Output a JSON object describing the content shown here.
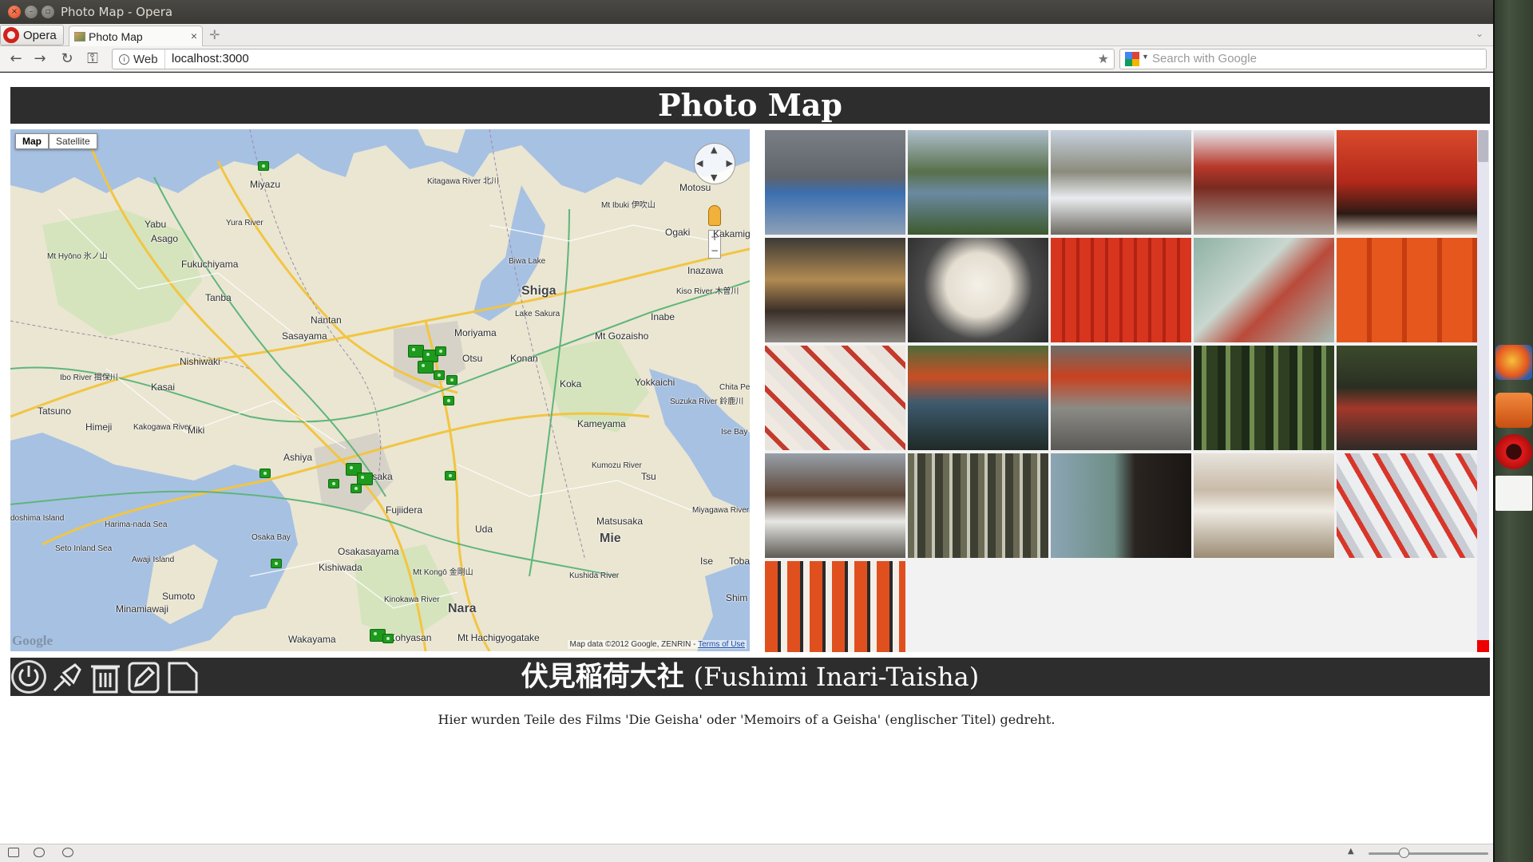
{
  "window": {
    "title": "Photo Map - Opera"
  },
  "browser": {
    "menu_label": "Opera",
    "tab_title": "Photo Map",
    "tab_close": "×",
    "address_prefix": "Web",
    "url": "localhost:3000",
    "search_placeholder": "Search with Google"
  },
  "page": {
    "header": "Photo Map",
    "map": {
      "type_buttons": [
        "Map",
        "Satellite"
      ],
      "active_type": "Map",
      "labels": [
        "Miyazu",
        "Mt Ibuki 伊吹山",
        "Motosu",
        "Kitagawa River 北川",
        "Yura River",
        "Yabu",
        "Asago",
        "Mt Hyōno 氷ノ山",
        "Fukuchiyama",
        "Biwa Lake",
        "Shiga",
        "Ogaki",
        "Kakamig",
        "Inazawa",
        "Kiso River 木曽川",
        "Tanba",
        "Nantan",
        "Lake Sakura",
        "Inabe",
        "Sasayama",
        "Moriyama",
        "Mt Gozaisho",
        "Nishiwaki",
        "Otsu",
        "Konan",
        "Ibo River 揖保川",
        "Kasai",
        "Koka",
        "Yokkaichi",
        "Suzuka River 鈴鹿川",
        "Chita Peninsu",
        "Tatsuno",
        "Himeji",
        "Kakogawa River",
        "Miki",
        "Kameyama",
        "Ise Bay 伊勢湾",
        "Ashiya",
        "Kumozu River",
        "Tsu",
        "Osaka",
        "Fujiidera",
        "Uda",
        "Miyagawa River",
        "Harima-nada Sea",
        "Seto Inland Sea",
        "Awaji Island",
        "Osaka Bay",
        "Osakasayama",
        "Matsusaka",
        "Mie",
        "Ise",
        "Kishiwada",
        "Mt Kongō 金剛山",
        "Kushida River",
        "Toba",
        "Sumoto",
        "Minamiawaji",
        "Kinokawa River",
        "Nara",
        "Shim",
        "Wakayama",
        "Mt Hachigyogatake",
        "doshima Island",
        "Kohyasan"
      ],
      "copyright": "Map data ©2012 Google, ZENRIN",
      "terms": "Terms of Use",
      "logo": "Google"
    },
    "gallery": {
      "photos": [
        {
          "alt": "pilgrim-on-bridge"
        },
        {
          "alt": "canal-with-trees"
        },
        {
          "alt": "street-with-car"
        },
        {
          "alt": "shrine-gate-steps"
        },
        {
          "alt": "red-shrine-building"
        },
        {
          "alt": "wooden-plaques"
        },
        {
          "alt": "paper-lantern"
        },
        {
          "alt": "red-votive-rack"
        },
        {
          "alt": "shrine-map-board"
        },
        {
          "alt": "torii-inscriptions"
        },
        {
          "alt": "fox-ema-plaques"
        },
        {
          "alt": "pond-and-tea-house"
        },
        {
          "alt": "small-torii"
        },
        {
          "alt": "bamboo-forest"
        },
        {
          "alt": "forest-torii-path"
        },
        {
          "alt": "vending-machine"
        },
        {
          "alt": "bamboo-grove"
        },
        {
          "alt": "garden-umbrella"
        },
        {
          "alt": "tatami-room"
        },
        {
          "alt": "fox-figurines"
        },
        {
          "alt": "miniature-torii"
        }
      ]
    },
    "selected": {
      "title_jp": "伏見稲荷大社",
      "title_roman": "(Fushimi Inari-Taisha)",
      "description": "Hier wurden Teile des Films 'Die Geisha' oder 'Memoirs of a Geisha' (englischer Titel) gedreht."
    },
    "toolbar": [
      "power-icon",
      "pin-icon",
      "trash-icon",
      "pencil-icon",
      "page-icon"
    ]
  },
  "colors": {
    "header_bg": "#2d2d2d",
    "marker": "#1e9a1e",
    "accent": "#d1211b"
  }
}
